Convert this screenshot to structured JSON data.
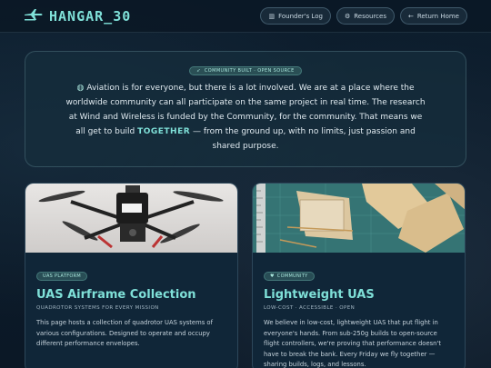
{
  "header": {
    "title": "HANGAR_30",
    "nav": [
      {
        "icon": "book-icon",
        "label": "Founder's Log"
      },
      {
        "icon": "gear-icon",
        "label": "Resources"
      },
      {
        "icon": "arrow-left-icon",
        "label": "Return Home"
      }
    ]
  },
  "hero": {
    "badge": "COMMUNITY BUILT · OPEN SOURCE",
    "text_before": "Aviation is for everyone, but there is a lot involved. We are at a place where the worldwide community can all participate on the same project in real time. The research at Wind and Wireless is funded by the Community, for the community. That means we all get to build ",
    "highlight": "TOGETHER",
    "text_after": " — from the ground up, with no limits, just passion and shared purpose."
  },
  "cards": [
    {
      "tag": "UAS PLATFORM",
      "title": "UAS Airframe Collection",
      "subtitle": "QUADROTOR SYSTEMS FOR EVERY MISSION",
      "description": "This page hosts a collection of quadrotor UAS systems of various configurations. Designed to operate and occupy different performance envelopes."
    },
    {
      "tag": "COMMUNITY",
      "title": "Lightweight UAS",
      "subtitle": "LOW-COST · ACCESSIBLE · OPEN",
      "description": "We believe in low-cost, lightweight UAS that put flight in everyone's hands. From sub-250g builds to open-source flight controllers, we're proving that performance doesn't have to break the bank. Every Friday we fly together — sharing builds, logs, and lessons."
    }
  ],
  "colors": {
    "accent": "#7fe0d8",
    "background": "#0c1b2a",
    "card": "#102638"
  }
}
